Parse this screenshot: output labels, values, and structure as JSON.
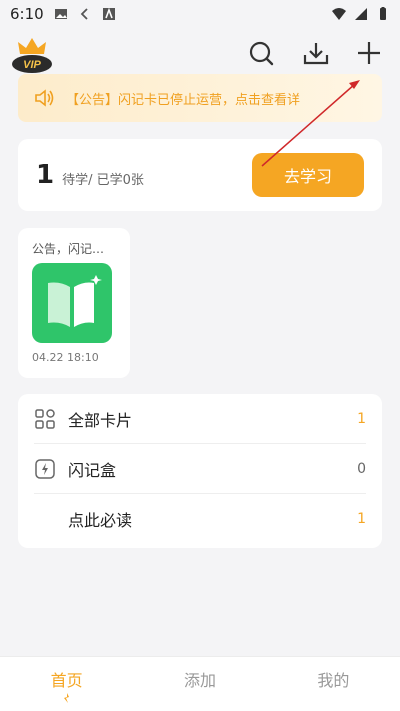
{
  "status_bar": {
    "time": "6:10"
  },
  "notice": {
    "text": "【公告】闪记卡已停止运营，点击查看详"
  },
  "study": {
    "count": "1",
    "subtitle": "待学/ 已学0张",
    "button": "去学习"
  },
  "deck": {
    "title": "公告，闪记…",
    "time": "04.22 18:10"
  },
  "list": [
    {
      "label": "全部卡片",
      "count": "1",
      "icon": "grid-icon"
    },
    {
      "label": "闪记盒",
      "count": "0",
      "icon": "lightning-box-icon"
    },
    {
      "label": "点此必读",
      "count": "1",
      "icon": ""
    }
  ],
  "tabs": [
    {
      "label": "首页",
      "active": true
    },
    {
      "label": "添加",
      "active": false
    },
    {
      "label": "我的",
      "active": false
    }
  ],
  "colors": {
    "accent": "#f5a623",
    "green": "#2fc56a",
    "annotation": "#d0282a"
  }
}
